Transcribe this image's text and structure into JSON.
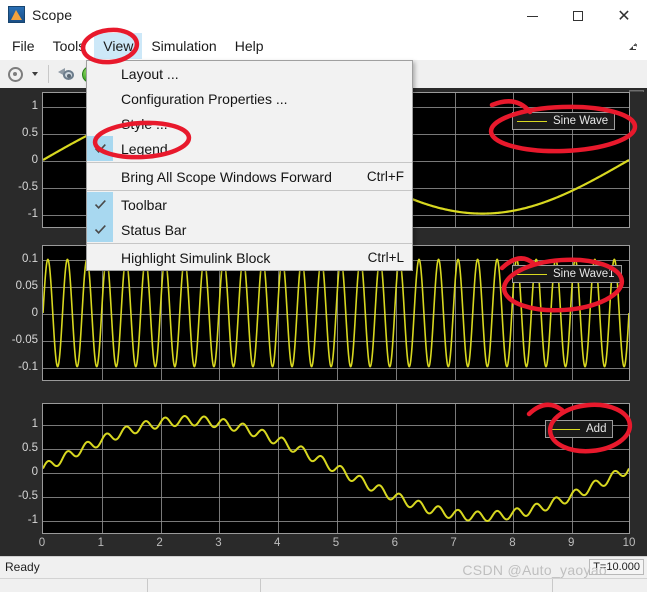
{
  "window": {
    "title": "Scope",
    "app_icon": "matlab-scope-icon",
    "minimize_label": "Minimize",
    "maximize_label": "Maximize",
    "close_label": "Close"
  },
  "menubar": {
    "items": [
      {
        "label": "File",
        "active": false
      },
      {
        "label": "Tools",
        "active": false
      },
      {
        "label": "View",
        "active": true
      },
      {
        "label": "Simulation",
        "active": false
      },
      {
        "label": "Help",
        "active": false
      }
    ],
    "overflow_icon": "menu-overflow-arrow-icon"
  },
  "toolbar": {
    "buttons": [
      {
        "name": "configuration-gear-button",
        "icon": "gear-icon"
      },
      {
        "name": "configuration-dropdown-button",
        "icon": "caret-down-icon"
      },
      {
        "name": "scope-configuration-button",
        "icon": "scope-config-icon"
      },
      {
        "name": "run-button",
        "icon": "play-icon"
      }
    ]
  },
  "view_menu": {
    "items": [
      {
        "label": "Layout ...",
        "checked": null,
        "shortcut": "",
        "separator_after": false
      },
      {
        "label": "Configuration Properties ...",
        "checked": null,
        "shortcut": "",
        "separator_after": false
      },
      {
        "label": "Style ...",
        "checked": null,
        "shortcut": "",
        "separator_after": false
      },
      {
        "label": "Legend",
        "checked": true,
        "shortcut": "",
        "separator_after": true
      },
      {
        "label": "Bring All Scope Windows Forward",
        "checked": null,
        "shortcut": "Ctrl+F",
        "separator_after": true
      },
      {
        "label": "Toolbar",
        "checked": true,
        "shortcut": "",
        "separator_after": false
      },
      {
        "label": "Status Bar",
        "checked": true,
        "shortcut": "",
        "separator_after": true
      },
      {
        "label": "Highlight Simulink Block",
        "checked": null,
        "shortcut": "Ctrl+L",
        "separator_after": false
      }
    ]
  },
  "scope": {
    "expand_icon": "expand-axes-icon",
    "trace_color": "#d8d820",
    "background_color": "#000000",
    "panel_color": "#2a2a2a",
    "grid_color": "#8e8e8e"
  },
  "statusbar": {
    "status": "Ready",
    "sim_time": "T=10.000"
  },
  "watermark": {
    "text": "CSDN @Auto_yaoyao"
  },
  "chart_data": [
    {
      "type": "line",
      "name": "plot-1",
      "title": "",
      "legend": "Sine Wave",
      "legend_position": "top-right",
      "xlabel": "",
      "ylabel": "",
      "xlim": [
        0,
        10
      ],
      "ylim": [
        -1.25,
        1.25
      ],
      "yticks": [
        1,
        0.5,
        0,
        -0.5,
        -1
      ],
      "ytick_labels": [
        "1",
        "0.5",
        "0",
        "-0.5",
        "-1"
      ],
      "xticks": [
        0,
        1,
        2,
        3,
        4,
        5,
        6,
        7,
        8,
        9,
        10
      ],
      "grid": true,
      "function": "sin(2*pi*t/10)",
      "amplitude": 1,
      "frequency_hz": 0.1,
      "samples_x": [
        0,
        0.5,
        1,
        1.5,
        2,
        2.5,
        3,
        3.5,
        4,
        4.5,
        5,
        5.5,
        6,
        6.5,
        7,
        7.5,
        8,
        8.5,
        9,
        9.5,
        10
      ],
      "samples_y": [
        0,
        0.309,
        0.588,
        0.809,
        0.951,
        1,
        0.951,
        0.809,
        0.588,
        0.309,
        0,
        -0.309,
        -0.588,
        -0.809,
        -0.951,
        -1,
        -0.951,
        -0.809,
        -0.588,
        -0.309,
        0
      ]
    },
    {
      "type": "line",
      "name": "plot-2",
      "title": "",
      "legend": "Sine Wave1",
      "legend_position": "top-right",
      "xlabel": "",
      "ylabel": "",
      "xlim": [
        0,
        10
      ],
      "ylim": [
        -0.125,
        0.125
      ],
      "yticks": [
        0.1,
        0.05,
        0,
        -0.05,
        -0.1
      ],
      "ytick_labels": [
        "0.1",
        "0.05",
        "0",
        "-0.05",
        "-0.1"
      ],
      "xticks": [
        0,
        1,
        2,
        3,
        4,
        5,
        6,
        7,
        8,
        9,
        10
      ],
      "grid": true,
      "function": "0.1*sin(2*pi*3*t)",
      "amplitude": 0.1,
      "cycles_visible": 30
    },
    {
      "type": "line",
      "name": "plot-3",
      "title": "",
      "legend": "Add",
      "legend_position": "top-right",
      "xlabel": "",
      "ylabel": "",
      "xlim": [
        0,
        10
      ],
      "ylim": [
        -1.35,
        1.35
      ],
      "yticks": [
        1,
        0.5,
        0,
        -0.5,
        -1
      ],
      "ytick_labels": [
        "1",
        "0.5",
        "0",
        "-0.5",
        "-1"
      ],
      "xticks": [
        0,
        1,
        2,
        3,
        4,
        5,
        6,
        7,
        8,
        9,
        10
      ],
      "xtick_labels": [
        "0",
        "1",
        "2",
        "3",
        "4",
        "5",
        "6",
        "7",
        "8",
        "9",
        "10"
      ],
      "grid": true,
      "function": "sin(2*pi*t/10) + 0.1*sin(2*pi*3*t)"
    }
  ]
}
